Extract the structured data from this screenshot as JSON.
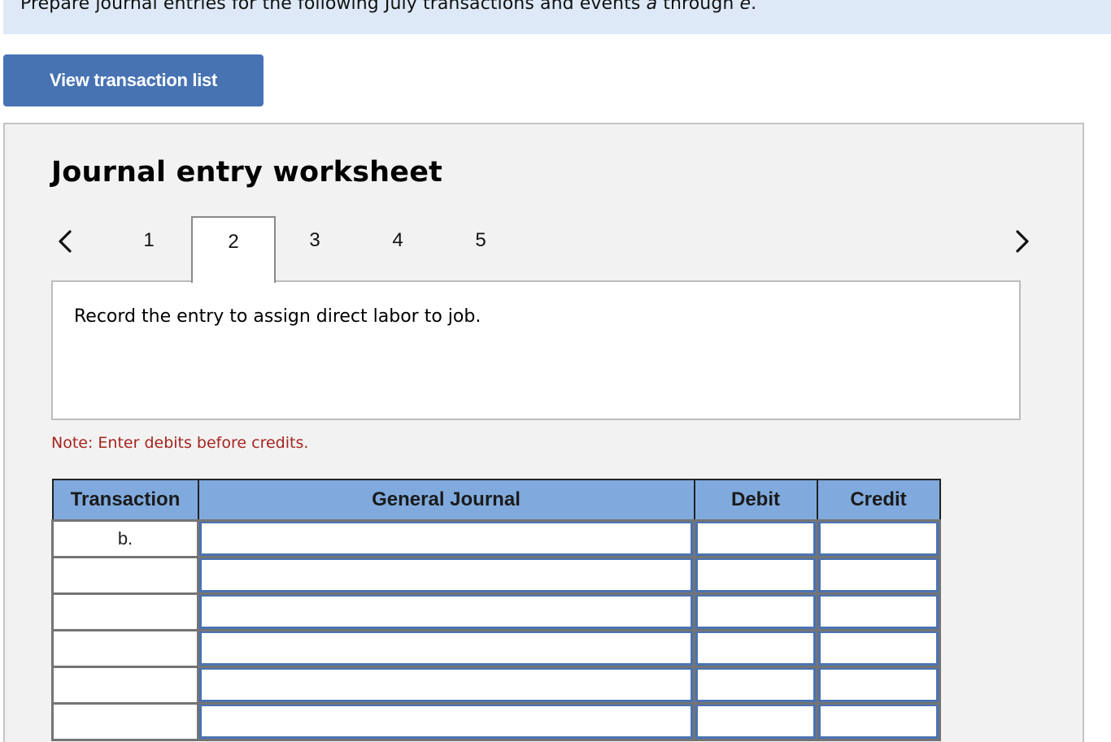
{
  "instruction": {
    "prefix": "Prepare journal entries for the following July transactions and events ",
    "a": "a",
    "middle": " through ",
    "e": "e",
    "suffix": "."
  },
  "buttons": {
    "view_transaction_list": "View transaction list"
  },
  "worksheet": {
    "title": "Journal entry worksheet",
    "nav": {
      "prev_icon": "chevron-left-icon",
      "next_icon": "chevron-right-icon"
    },
    "tabs": [
      {
        "label": "1",
        "active": false
      },
      {
        "label": "2",
        "active": true
      },
      {
        "label": "3",
        "active": false
      },
      {
        "label": "4",
        "active": false
      },
      {
        "label": "5",
        "active": false
      }
    ],
    "prompt": "Record the entry to assign direct labor to job.",
    "note": "Note: Enter debits before credits."
  },
  "journal": {
    "headers": [
      "Transaction",
      "General Journal",
      "Debit",
      "Credit"
    ],
    "rows": [
      {
        "transaction": "b.",
        "account": "",
        "debit": "",
        "credit": ""
      },
      {
        "transaction": "",
        "account": "",
        "debit": "",
        "credit": ""
      },
      {
        "transaction": "",
        "account": "",
        "debit": "",
        "credit": ""
      },
      {
        "transaction": "",
        "account": "",
        "debit": "",
        "credit": ""
      },
      {
        "transaction": "",
        "account": "",
        "debit": "",
        "credit": ""
      },
      {
        "transaction": "",
        "account": "",
        "debit": "",
        "credit": ""
      }
    ]
  },
  "colors": {
    "instruction_bg": "#dde9f7",
    "button_bg": "#4773b3",
    "worksheet_bg": "#f2f2f2",
    "header_bg": "#80aadd",
    "input_border": "#4a73b2",
    "note_text": "#a6241f"
  }
}
